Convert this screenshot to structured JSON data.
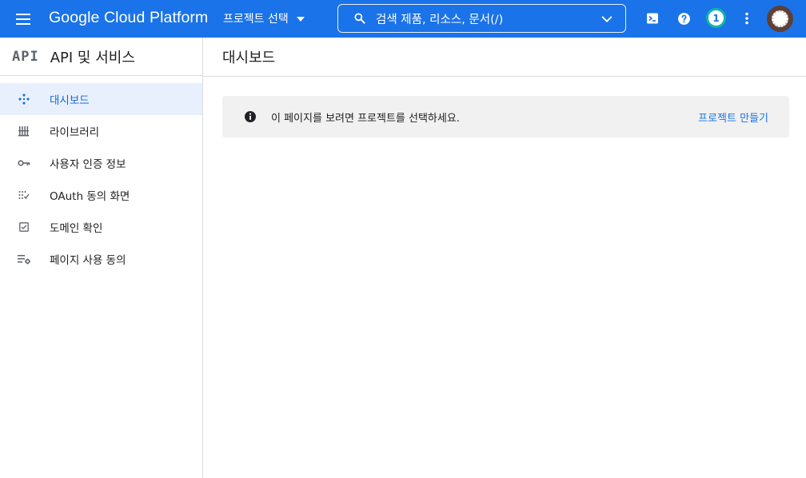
{
  "topbar": {
    "brand": "Google Cloud Platform",
    "project_picker_label": "프로젝트 선택",
    "search_label": "검색   제품, 리소스, 문서(/)",
    "notification_count": "1",
    "accent_color": "#1a73e8",
    "icons": [
      "menu-icon",
      "caret-down-icon",
      "search-icon",
      "chevron-down-icon",
      "cloud-shell-icon",
      "help-icon",
      "more-vert-icon"
    ]
  },
  "sidebar": {
    "logo_text": "API",
    "title": "API 및 서비스",
    "items": [
      {
        "label": "대시보드",
        "icon": "dashboard-icon",
        "active": true
      },
      {
        "label": "라이브러리",
        "icon": "library-icon",
        "active": false
      },
      {
        "label": "사용자 인증 정보",
        "icon": "key-icon",
        "active": false
      },
      {
        "label": "OAuth 동의 화면",
        "icon": "consent-icon",
        "active": false
      },
      {
        "label": "도메인 확인",
        "icon": "checkbox-icon",
        "active": false
      },
      {
        "label": "페이지 사용 동의",
        "icon": "settings-list-icon",
        "active": false
      }
    ]
  },
  "main": {
    "title": "대시보드",
    "notice": {
      "message": "이 페이지를 보려면 프로젝트를 선택하세요.",
      "action_label": "프로젝트 만들기"
    }
  }
}
